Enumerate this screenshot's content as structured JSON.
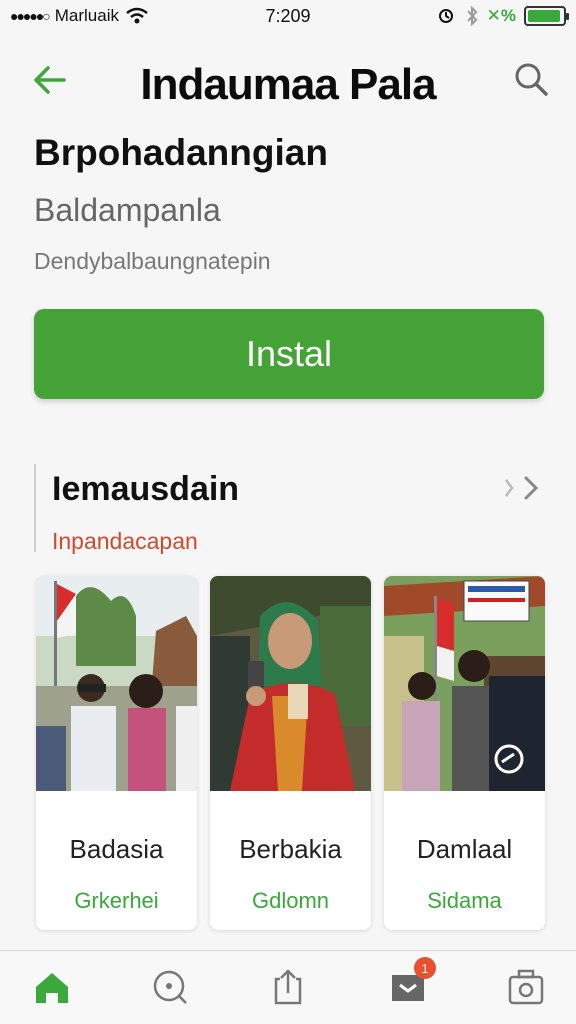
{
  "status_bar": {
    "carrier": "Marluaik",
    "time": "7:209",
    "battery_label": "%",
    "battery_level": 0.95,
    "accent": "#3aa83a"
  },
  "header": {
    "title": "Indaumaa Pala",
    "back_icon": "arrow-left-icon",
    "search_icon": "search-icon"
  },
  "app": {
    "name": "Brpohadanngian",
    "developer": "Baldampanla",
    "meta": "Dendybalbaungnatepin",
    "install_label": "Instal",
    "install_color": "#44a236"
  },
  "section": {
    "title": "Iemausdain",
    "subtitle": "Inpandacapan",
    "more_icon": "chevron-right-icon"
  },
  "cards": [
    {
      "title": "Badasia",
      "subtitle": "Grkerhei"
    },
    {
      "title": "Berbakia",
      "subtitle": "Gdlomn"
    },
    {
      "title": "Damlaal",
      "subtitle": "Sidama"
    }
  ],
  "bottom_nav": {
    "items": [
      "home-icon",
      "search-icon",
      "share-icon",
      "inbox-icon",
      "camera-icon"
    ],
    "inbox_badge": "1"
  }
}
